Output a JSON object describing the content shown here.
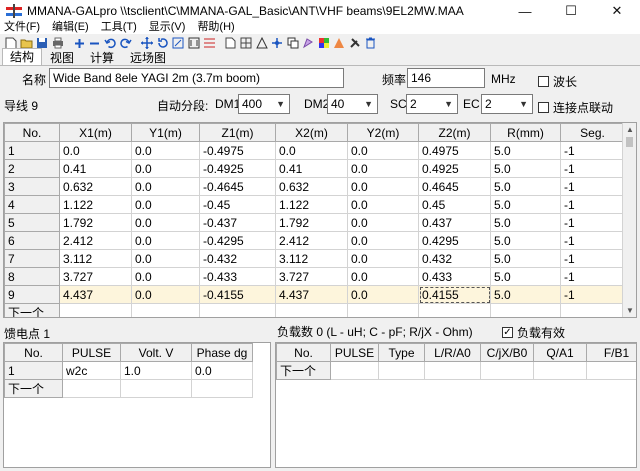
{
  "window": {
    "title": "MMANA-GALpro \\\\tsclient\\C\\MMANA-GAL_Basic\\ANT\\VHF beams\\9EL2MW.MAA",
    "minimize": "—",
    "maximize": "☐",
    "close": "✕"
  },
  "menu": {
    "items": [
      "文件(F)",
      "编辑(E)",
      "工具(T)",
      "显示(V)",
      "帮助(H)"
    ]
  },
  "toolbar": {
    "icons": [
      "new-file-icon",
      "open-folder-icon",
      "save-icon",
      "print-icon",
      "add-icon",
      "remove-icon",
      "undo-icon",
      "redo-icon",
      "move-icon",
      "rotate-icon",
      "scale-icon",
      "stretch-icon",
      "wire-list-icon",
      "page-icon",
      "grid-icon",
      "triangle-icon",
      "copy-icon",
      "duplicate-icon",
      "shape-icon",
      "color-icon",
      "chart-icon",
      "tools-icon",
      "trash-icon"
    ]
  },
  "tabs": [
    {
      "label": "结构",
      "active": true
    },
    {
      "label": "视图",
      "active": false
    },
    {
      "label": "计算",
      "active": false
    },
    {
      "label": "远场图",
      "active": false
    }
  ],
  "header": {
    "name_label": "名称",
    "name_value": "Wide Band 8ele YAGI 2m (3.7m boom)",
    "freq_label": "频率",
    "freq_value": "146",
    "freq_unit": "MHz",
    "wavelength_label": "波长",
    "wire_count_label": "导线 9",
    "auto_seg_label": "自动分段:",
    "dm1_label": "DM1",
    "dm1_value": "400",
    "dm2_label": "DM2",
    "dm2_value": "40",
    "sc_label": "SC",
    "sc_value": "2",
    "ec_label": "EC",
    "ec_value": "2",
    "link_label": "连接点联动"
  },
  "wires": {
    "columns": [
      "No.",
      "X1(m)",
      "Y1(m)",
      "Z1(m)",
      "X2(m)",
      "Y2(m)",
      "Z2(m)",
      "R(mm)",
      "Seg."
    ],
    "rows": [
      [
        "1",
        "0.0",
        "0.0",
        "-0.4975",
        "0.0",
        "0.0",
        "0.4975",
        "5.0",
        "-1"
      ],
      [
        "2",
        "0.41",
        "0.0",
        "-0.4925",
        "0.41",
        "0.0",
        "0.4925",
        "5.0",
        "-1"
      ],
      [
        "3",
        "0.632",
        "0.0",
        "-0.4645",
        "0.632",
        "0.0",
        "0.4645",
        "5.0",
        "-1"
      ],
      [
        "4",
        "1.122",
        "0.0",
        "-0.45",
        "1.122",
        "0.0",
        "0.45",
        "5.0",
        "-1"
      ],
      [
        "5",
        "1.792",
        "0.0",
        "-0.437",
        "1.792",
        "0.0",
        "0.437",
        "5.0",
        "-1"
      ],
      [
        "6",
        "2.412",
        "0.0",
        "-0.4295",
        "2.412",
        "0.0",
        "0.4295",
        "5.0",
        "-1"
      ],
      [
        "7",
        "3.112",
        "0.0",
        "-0.432",
        "3.112",
        "0.0",
        "0.432",
        "5.0",
        "-1"
      ],
      [
        "8",
        "3.727",
        "0.0",
        "-0.433",
        "3.727",
        "0.0",
        "0.433",
        "5.0",
        "-1"
      ],
      [
        "9",
        "4.437",
        "0.0",
        "-0.4155",
        "4.437",
        "0.0",
        "0.4155",
        "5.0",
        "-1"
      ]
    ],
    "next_row_label": "下一个"
  },
  "feed": {
    "title": "馈电点 1",
    "columns": [
      "No.",
      "PULSE",
      "Volt. V",
      "Phase dg"
    ],
    "rows": [
      [
        "1",
        "w2c",
        "1.0",
        "0.0"
      ]
    ],
    "next_row_label": "下一个"
  },
  "loads": {
    "title": "负载数 0 (L - uH; C - pF; R/jX - Ohm)",
    "enabled_label": "负载有效",
    "columns": [
      "No.",
      "PULSE",
      "Type",
      "L/R/A0",
      "C/jX/B0",
      "Q/A1",
      "F/B1"
    ],
    "next_row_label": "下一个"
  }
}
